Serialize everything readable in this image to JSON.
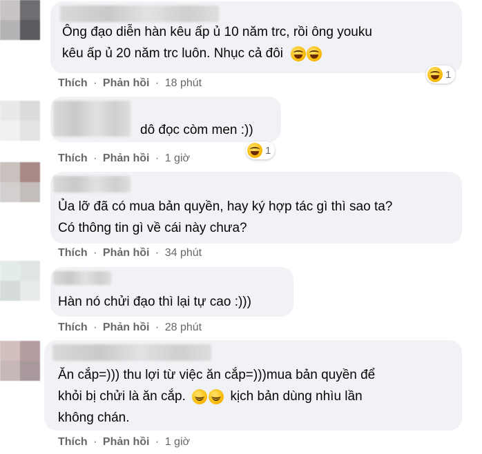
{
  "action_like": "Thích",
  "action_reply": "Phản hồi",
  "separator": "·",
  "comments": [
    {
      "lines": [
        "Ông đạo diễn hàn kêu ấp ủ 10 năm trc, rồi ông youku",
        "kêu ấp ủ 20 năm trc luôn. Nhục cả đôi"
      ],
      "time": "18 phút",
      "reaction_count": "1",
      "reaction_icon": "laughing-emoji-icon"
    },
    {
      "lines": [
        "dô đọc còm men :))"
      ],
      "time": "1 giờ",
      "reaction_count": "1",
      "reaction_icon": "laughing-emoji-icon"
    },
    {
      "lines": [
        "Ủa lỡ đã có mua bản quyền, hay ký hợp tác gì thì sao ta?",
        "Có thông tin gì về cái này chưa?"
      ],
      "time": "34 phút"
    },
    {
      "lines": [
        "Hàn nó chửi đạo thì lại tự cao :)))"
      ],
      "time": "28 phút"
    },
    {
      "lines": [
        "Ăn cắp=))) thu lợi từ việc ăn cắp=)))mua bản quyền để",
        "khỏi bị chửi là ăn cắp.",
        "kịch bản dùng nhìu lần",
        "không chán."
      ],
      "time": "1 giờ"
    }
  ],
  "emoji_names": {
    "rofl": "rolling-on-floor-laughing-emoji-icon",
    "relieved": "relieved-face-emoji-icon"
  }
}
